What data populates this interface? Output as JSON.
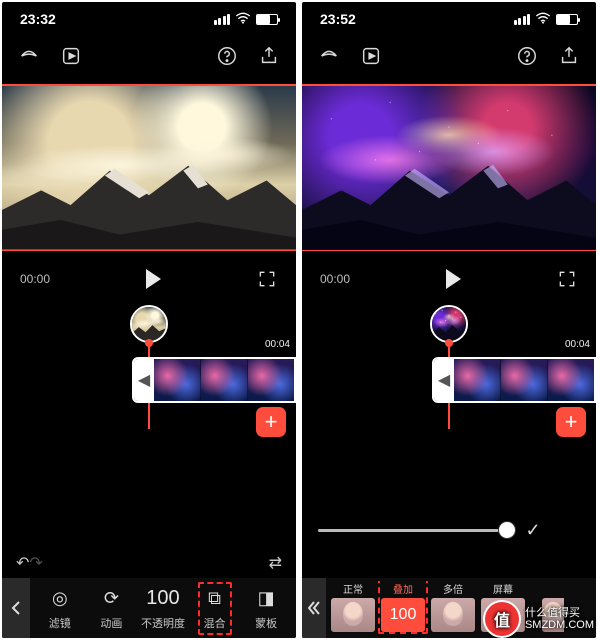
{
  "watermark": {
    "line1": "什么值得买",
    "line2": "SMZDM.COM",
    "badge": "值"
  },
  "left": {
    "status": {
      "time": "23:32"
    },
    "transport": {
      "current_time": "00:00"
    },
    "timeline": {
      "clip_end_label": "00:04"
    },
    "toolrow": {
      "undo": "↶",
      "redo": "↷",
      "swap": "⇄"
    },
    "effects": [
      {
        "id": "filter",
        "label": "滤镜",
        "icon": "◎"
      },
      {
        "id": "anim",
        "label": "动画",
        "icon": "⟳"
      },
      {
        "id": "opacity",
        "label": "不透明度",
        "icon": "100",
        "isText": true
      },
      {
        "id": "blend",
        "label": "混合",
        "icon": "⧉",
        "highlight": true
      },
      {
        "id": "mask",
        "label": "蒙板",
        "icon": "◨"
      }
    ]
  },
  "right": {
    "status": {
      "time": "23:52"
    },
    "transport": {
      "current_time": "00:00"
    },
    "timeline": {
      "clip_end_label": "00:04"
    },
    "slider_check": "✓",
    "blend_modes": [
      {
        "id": "normal",
        "label": "正常"
      },
      {
        "id": "overlay",
        "label": "叠加",
        "selected": true,
        "value": "100"
      },
      {
        "id": "multiply",
        "label": "多倍"
      },
      {
        "id": "screen",
        "label": "屏幕"
      },
      {
        "id": "more",
        "label": "",
        "half": true
      }
    ]
  }
}
